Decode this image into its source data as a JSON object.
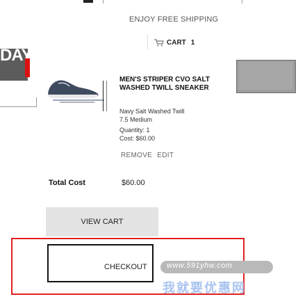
{
  "header": {
    "shipping_text": "ENJOY FREE SHIPPING",
    "cart_label": "CART",
    "cart_count": "1",
    "cart_icon": "cart-icon"
  },
  "promo": {
    "text": "DAY."
  },
  "product": {
    "title": "MEN'S STRIPER CVO SALT WASHED TWILL SNEAKER",
    "color": "Navy Salt Washed Twill",
    "size": "7.5 Medium",
    "quantity": "Quantity: 1",
    "cost": "Cost: $60.00",
    "remove_label": "REMOVE",
    "edit_label": "EDIT"
  },
  "summary": {
    "total_label": "Total Cost",
    "total_value": "$60.00"
  },
  "actions": {
    "view_cart_label": "VIEW CART",
    "checkout_label": "CHECKOUT"
  },
  "watermark": {
    "url": "www.591yhw.com",
    "text": "我就要优惠网"
  },
  "colors": {
    "accent_red": "#e02020",
    "panel_gray": "#5c5c5c",
    "button_gray": "#e3e3e3"
  }
}
